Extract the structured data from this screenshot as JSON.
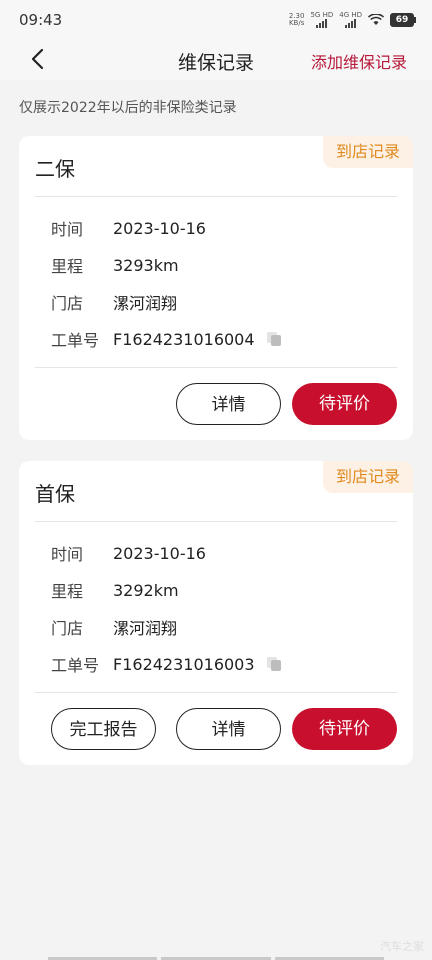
{
  "status": {
    "time": "09:43",
    "net_speed": "2.30",
    "net_unit": "KB/s",
    "sig1": "5G HD",
    "sig2": "4G HD",
    "battery": "69"
  },
  "nav": {
    "title": "维保记录",
    "action": "添加维保记录"
  },
  "notice": "仅展示2022年以后的非保险类记录",
  "records": [
    {
      "title": "二保",
      "tag": "到店记录",
      "time_label": "时间",
      "time": "2023-10-16",
      "mileage_label": "里程",
      "mileage": "3293km",
      "store_label": "门店",
      "store": "漯河润翔",
      "order_label": "工单号",
      "order": "F1624231016004",
      "buttons": {
        "detail": "详情",
        "rate": "待评价"
      }
    },
    {
      "title": "首保",
      "tag": "到店记录",
      "time_label": "时间",
      "time": "2023-10-16",
      "mileage_label": "里程",
      "mileage": "3292km",
      "store_label": "门店",
      "store": "漯河润翔",
      "order_label": "工单号",
      "order": "F1624231016003",
      "buttons": {
        "report": "完工报告",
        "detail": "详情",
        "rate": "待评价"
      }
    }
  ],
  "watermark": "汽车之家",
  "colors": {
    "brand": "#c8102e",
    "tag_text": "#e08a1e",
    "tag_bg": "#fdf1e6"
  }
}
